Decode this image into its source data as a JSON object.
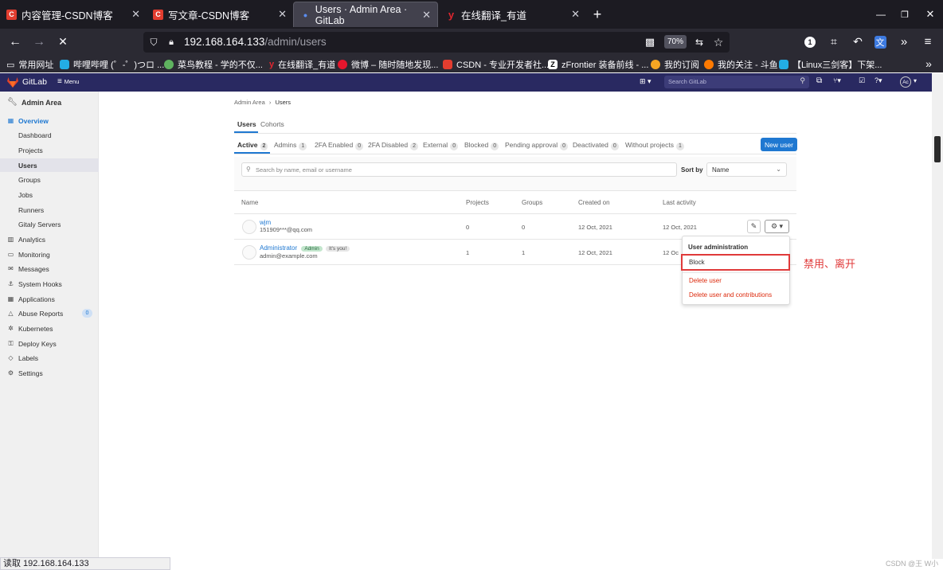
{
  "browser": {
    "tabs": [
      {
        "title": "内容管理-CSDN博客",
        "icon_color": "#e33d2f",
        "icon_glyph": "C"
      },
      {
        "title": "写文章-CSDN博客",
        "icon_color": "#e33d2f",
        "icon_glyph": "C"
      },
      {
        "title": "Users · Admin Area · GitLab",
        "icon_color": "#5b8def",
        "icon_glyph": "•"
      },
      {
        "title": "在线翻译_有道",
        "icon_color": "#e0262f",
        "icon_glyph": "y"
      }
    ],
    "url_host": "192.168.164.133",
    "url_path": "/admin/users",
    "zoom": "70%",
    "bookmarks": [
      {
        "label": "常用网址",
        "color": "#cfcfd8"
      },
      {
        "label": "哔哩哔哩 (゜-゜)つロ ...",
        "color": "#23ade5"
      },
      {
        "label": "菜鸟教程 - 学的不仅...",
        "color": "#5fb35f"
      },
      {
        "label": "在线翻译_有道",
        "color": "#e0262f"
      },
      {
        "label": "微博 – 随时随地发现...",
        "color": "#e6162d"
      },
      {
        "label": "CSDN - 专业开发者社...",
        "color": "#e33d2f"
      },
      {
        "label": "zFrontier 装备前线 - ...",
        "color": "#ffffff"
      },
      {
        "label": "我的订阅",
        "color": "#f5a623"
      },
      {
        "label": "我的关注 - 斗鱼",
        "color": "#ff7a00"
      },
      {
        "label": "【Linux三剑客】下架...",
        "color": "#23ade5"
      }
    ],
    "status_text": "读取 192.168.164.133"
  },
  "gitlab": {
    "brand": "GitLab",
    "menu": "Menu",
    "search_placeholder": "Search GitLab",
    "avatar_initials": "Ac"
  },
  "sidebar": {
    "title": "Admin Area",
    "items": [
      {
        "label": "Overview",
        "icon": "grid-icon",
        "glyph": "▦",
        "active_section": true
      },
      {
        "label": "Dashboard",
        "sub": true
      },
      {
        "label": "Projects",
        "sub": true
      },
      {
        "label": "Users",
        "sub": true,
        "active": true
      },
      {
        "label": "Groups",
        "sub": true
      },
      {
        "label": "Jobs",
        "sub": true
      },
      {
        "label": "Runners",
        "sub": true
      },
      {
        "label": "Gitaly Servers",
        "sub": true
      },
      {
        "label": "Analytics",
        "icon": "chart-icon",
        "glyph": "▥"
      },
      {
        "label": "Monitoring",
        "icon": "monitor-icon",
        "glyph": "▭"
      },
      {
        "label": "Messages",
        "icon": "message-icon",
        "glyph": "✉"
      },
      {
        "label": "System Hooks",
        "icon": "hook-icon",
        "glyph": "⚓"
      },
      {
        "label": "Applications",
        "icon": "apps-icon",
        "glyph": "▦"
      },
      {
        "label": "Abuse Reports",
        "icon": "warning-icon",
        "glyph": "△",
        "count": "0"
      },
      {
        "label": "Kubernetes",
        "icon": "kubernetes-icon",
        "glyph": "✲"
      },
      {
        "label": "Deploy Keys",
        "icon": "key-icon",
        "glyph": "⚿"
      },
      {
        "label": "Labels",
        "icon": "label-icon",
        "glyph": "◇"
      },
      {
        "label": "Settings",
        "icon": "settings-icon",
        "glyph": "⚙"
      }
    ]
  },
  "breadcrumb": [
    "Admin Area",
    "Users"
  ],
  "top_tabs": [
    "Users",
    "Cohorts"
  ],
  "filter_tabs": [
    {
      "label": "Active",
      "count": "2"
    },
    {
      "label": "Admins",
      "count": "1"
    },
    {
      "label": "2FA Enabled",
      "count": "0"
    },
    {
      "label": "2FA Disabled",
      "count": "2"
    },
    {
      "label": "External",
      "count": "0"
    },
    {
      "label": "Blocked",
      "count": "0"
    },
    {
      "label": "Pending approval",
      "count": "0"
    },
    {
      "label": "Deactivated",
      "count": "0"
    },
    {
      "label": "Without projects",
      "count": "1"
    }
  ],
  "new_user": "New user",
  "search_users_placeholder": "Search by name, email or username",
  "sort_by_label": "Sort by",
  "sort_value": "Name",
  "table": {
    "headers": [
      "Name",
      "Projects",
      "Groups",
      "Created on",
      "Last activity"
    ],
    "rows": [
      {
        "name": "wjm",
        "email": "151909***@qq.com",
        "projects": "0",
        "groups": "0",
        "created": "12 Oct, 2021",
        "last": "12 Oct, 2021"
      },
      {
        "name": "Administrator",
        "email": "admin@example.com",
        "badge_admin": "Admin",
        "badge_you": "It's you!",
        "projects": "1",
        "groups": "1",
        "created": "12 Oct, 2021",
        "last": "12 Oc"
      }
    ]
  },
  "dropdown": {
    "header": "User administration",
    "block": "Block",
    "delete_user": "Delete user",
    "delete_contrib": "Delete user and contributions"
  },
  "annotation": "禁用、离开",
  "watermark": "CSDN @王 W小"
}
